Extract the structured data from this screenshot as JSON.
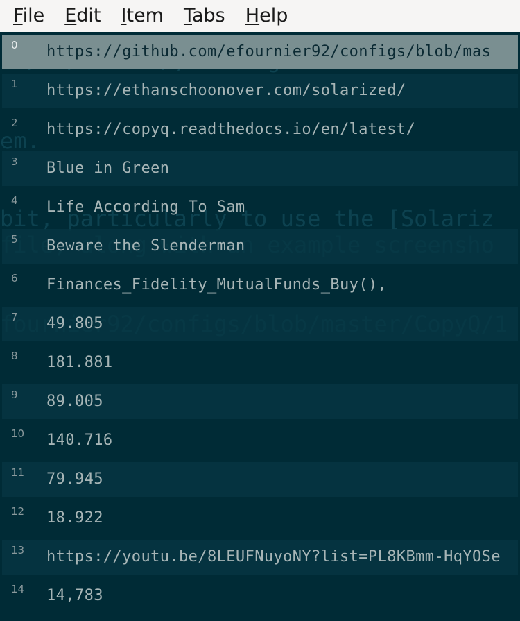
{
  "menu": [
    "File",
    "Edit",
    "Item",
    "Tabs",
    "Help"
  ],
  "background_ghost_text": [
    "io/en/latest/) Configuration",
    "em.",
    "bit, particularly to use the [Solariz",
    "file, along with an example screensho",
    "fournier92/configs/blob/master/CopyQ/1"
  ],
  "items": [
    {
      "index": "0",
      "text": "https://github.com/efournier92/configs/blob/mas"
    },
    {
      "index": "1",
      "text": "https://ethanschoonover.com/solarized/"
    },
    {
      "index": "2",
      "text": "https://copyq.readthedocs.io/en/latest/"
    },
    {
      "index": "3",
      "text": "Blue in Green"
    },
    {
      "index": "4",
      "text": "Life According To Sam"
    },
    {
      "index": "5",
      "text": "Beware the Slenderman"
    },
    {
      "index": "6",
      "text": "Finances_Fidelity_MutualFunds_Buy(),"
    },
    {
      "index": "7",
      "text": "49.805"
    },
    {
      "index": "8",
      "text": "181.881"
    },
    {
      "index": "9",
      "text": "89.005"
    },
    {
      "index": "10",
      "text": "140.716"
    },
    {
      "index": "11",
      "text": "79.945"
    },
    {
      "index": "12",
      "text": "18.922"
    },
    {
      "index": "13",
      "text": "https://youtu.be/8LEUFNuyoNY?list=PL8KBmm-HqYOSe"
    },
    {
      "index": "14",
      "text": "14,783"
    }
  ],
  "selected_index": 0,
  "colors": {
    "background": "#002b36",
    "row_alt": "#073642",
    "selected": "#7a8f91",
    "text": "#a7b5b6"
  }
}
